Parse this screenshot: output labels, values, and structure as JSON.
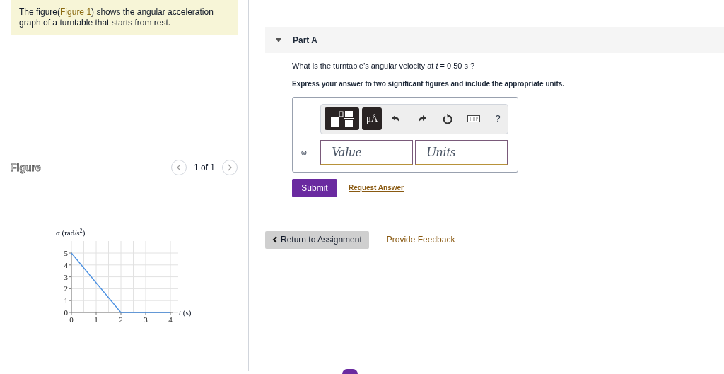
{
  "intro": {
    "before": "The figure(",
    "link": "Figure 1",
    "after": ") shows the angular acceleration graph of a turntable that starts from rest."
  },
  "figure": {
    "heading": "Figure",
    "pager": "1 of 1",
    "chart_data": {
      "type": "line",
      "ylabel": "α (rad/s$^{2}$)",
      "xlabel": "*t* (s)",
      "x": [
        0,
        2,
        4
      ],
      "series": [
        {
          "color": "#4a90e2",
          "values": [
            5,
            0,
            0
          ]
        }
      ],
      "grid": true,
      "xlim": [
        0,
        4
      ],
      "ylim": [
        0,
        5
      ],
      "xticks": [
        0,
        1,
        2,
        3,
        4
      ],
      "yticks": [
        0,
        1,
        2,
        3,
        4,
        5
      ]
    }
  },
  "part": {
    "title": "Part A",
    "expanded": true,
    "question": "What is the turntable’s angular velocity at *t* = 0.50 s ?",
    "instruction": "Express your answer to two significant figures and include the appropriate units.",
    "answer": {
      "variable": "ω =",
      "units_tool": "μÅ",
      "help": "?",
      "value": {
        "placeholder": "Value"
      },
      "units": {
        "placeholder": "Units"
      }
    },
    "submit": "Submit",
    "request": "Request Answer"
  },
  "footer": {
    "back": "Return to Assignment",
    "feedback": "Provide Feedback"
  }
}
